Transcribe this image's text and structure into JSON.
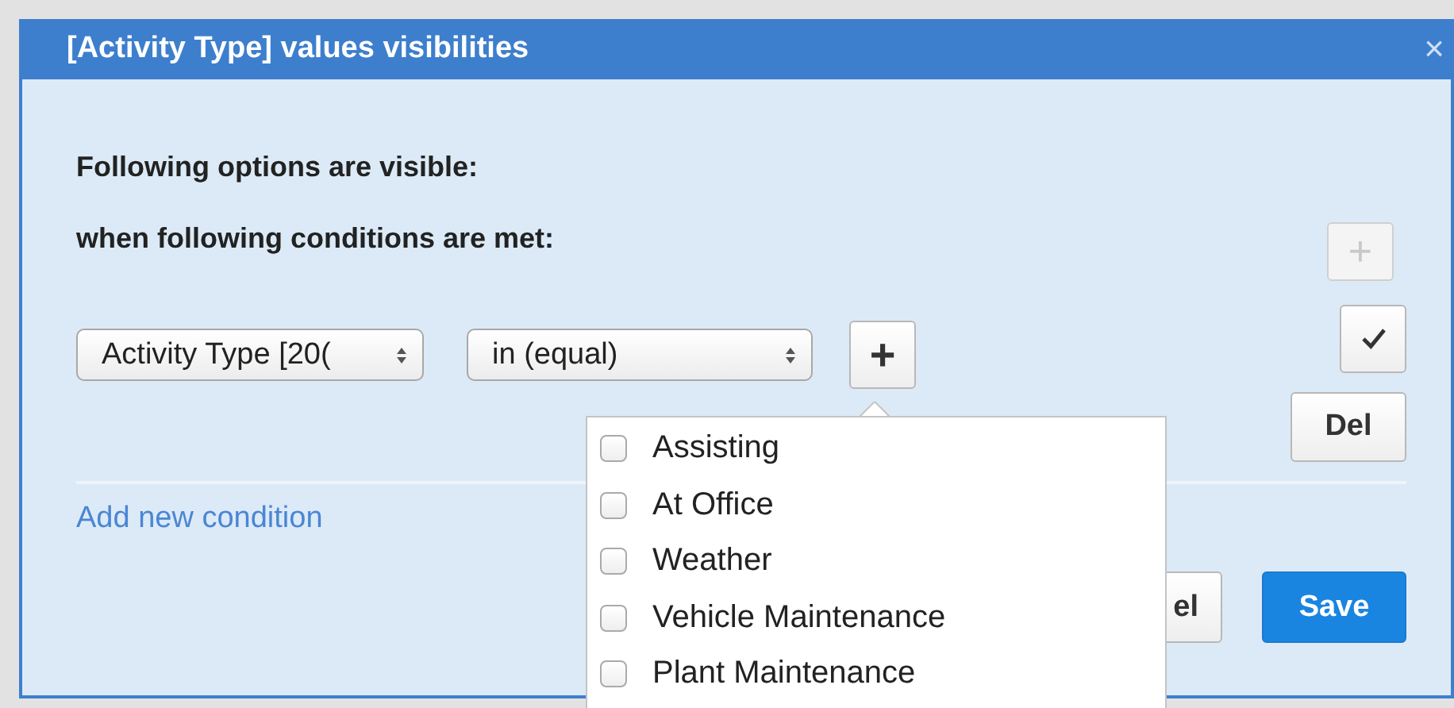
{
  "dialog": {
    "title": "[Activity Type] values visibilities",
    "close": "×"
  },
  "labels": [
    "Following options are visible:",
    "when following conditions are met:"
  ],
  "top_add_button": {
    "label": "+",
    "disabled": true
  },
  "condition": {
    "field": "Activity Type [20(",
    "operator": "in (equal)",
    "add_label": "+"
  },
  "side_buttons": [
    {
      "kind": "check"
    },
    {
      "kind": "text",
      "label": "Del"
    }
  ],
  "add_condition_link": "Add new condition",
  "popup_options": [
    {
      "label": "Assisting",
      "checked": false
    },
    {
      "label": "At Office",
      "checked": false
    },
    {
      "label": "Weather",
      "checked": false
    },
    {
      "label": "Vehicle Maintenance",
      "checked": false
    },
    {
      "label": "Plant Maintenance",
      "checked": false
    }
  ],
  "footer_buttons": [
    {
      "label": "el",
      "primary": false
    },
    {
      "label": "Save",
      "primary": true
    }
  ]
}
